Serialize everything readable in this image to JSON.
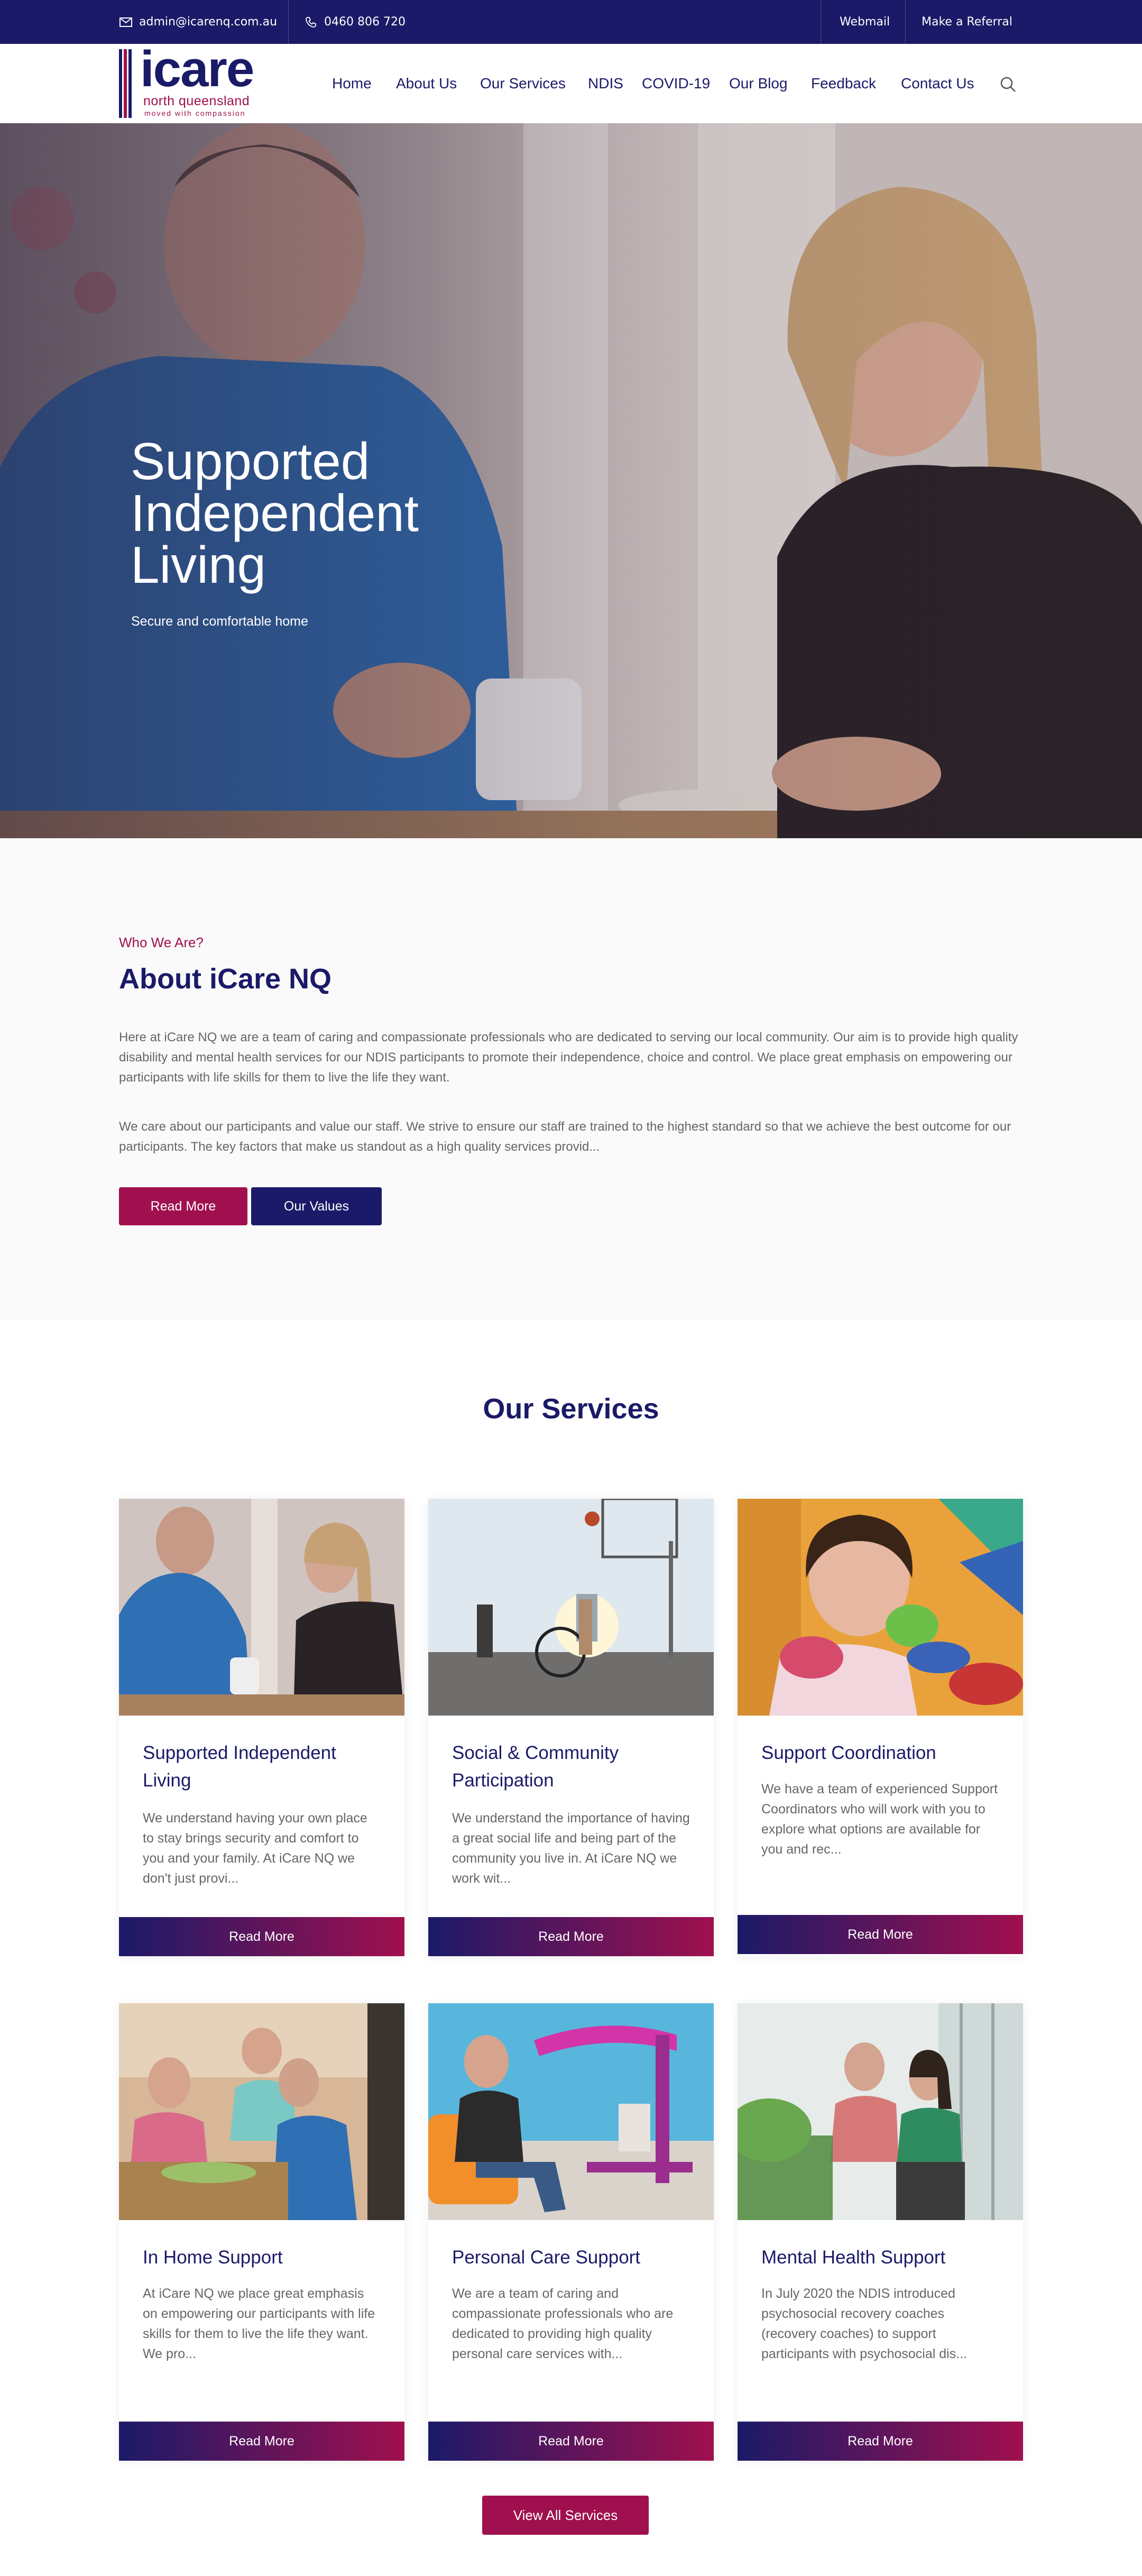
{
  "topbar": {
    "email": "admin@icarenq.com.au",
    "phone": "0460 806 720",
    "webmail": "Webmail",
    "referral": "Make a Referral"
  },
  "logo": {
    "word": "icare",
    "region": "north queensland",
    "tagline": "moved with compassion"
  },
  "nav": {
    "items": [
      "Home",
      "About Us",
      "Our Services",
      "NDIS",
      "COVID-19",
      "Our Blog",
      "Feedback",
      "Contact Us"
    ]
  },
  "hero": {
    "title": "Supported Independent Living",
    "subtitle": "Secure and comfortable home"
  },
  "about": {
    "eyebrow": "Who We Are?",
    "title": "About iCare NQ",
    "paragraph1": "Here at iCare NQ we are a team of caring and compassionate professionals who are dedicated to serving our local community. Our aim is to provide high quality disability and mental health services for our NDIS participants to promote their independence, choice and control. We place great emphasis on empowering our participants with life skills for them to live the life they want.",
    "paragraph2": "We care about our participants and value our staff. We strive to ensure our staff are trained to the highest standard so that we achieve the best outcome for our participants. The key factors that make us standout as a high quality services provid...",
    "read_more": "Read More",
    "our_values": "Our Values"
  },
  "services": {
    "title": "Our Services",
    "cards": [
      {
        "title": "Supported Independent Living",
        "description": "We understand having your own place to stay brings security and comfort to you and your family. At iCare NQ we don't just provi...",
        "button": "Read More"
      },
      {
        "title": "Social & Community Participation",
        "description": "We understand the importance of having a great social life and being part of the community you live in. At iCare NQ we work wit...",
        "button": "Read More"
      },
      {
        "title": "Support Coordination",
        "description": "We have a team of experienced Support Coordinators who will work with you to explore what options are available for you and rec...",
        "button": "Read More"
      },
      {
        "title": "In Home Support",
        "description": "At iCare NQ we place great emphasis on empowering our participants with life skills for them to live the life they want. We pro...",
        "button": "Read More"
      },
      {
        "title": "Personal Care Support",
        "description": "We are a team of caring and compassionate professionals who are dedicated to providing high quality personal care services with...",
        "button": "Read More"
      },
      {
        "title": "Mental Health Support",
        "description": "In July 2020 the NDIS introduced psychosocial recovery coaches (recovery coaches) to support participants with psychosocial dis...",
        "button": "Read More"
      }
    ],
    "view_all": "View All Services"
  },
  "colors": {
    "navy": "#1b1a68",
    "magenta": "#a0104e"
  }
}
